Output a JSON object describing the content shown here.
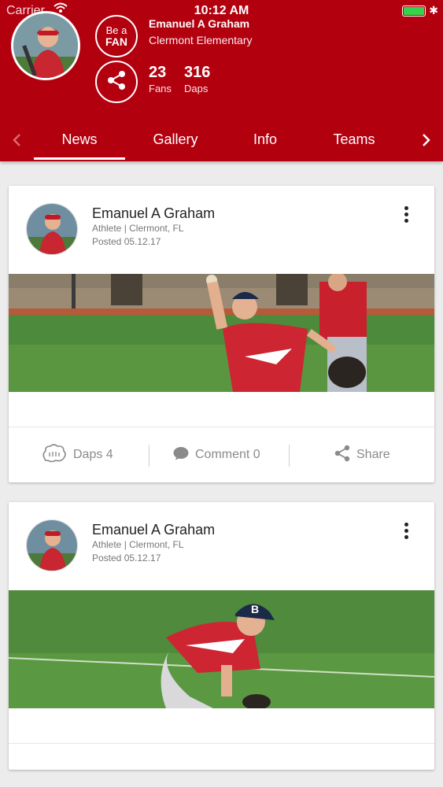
{
  "status_bar": {
    "carrier": "Carrier",
    "time": "10:12 AM"
  },
  "profile": {
    "name": "Emanuel A Graham",
    "school": "Clermont Elementary",
    "fan_button": {
      "line1": "Be a",
      "line2": "FAN"
    },
    "stats": [
      {
        "value": "23",
        "label": "Fans"
      },
      {
        "value": "316",
        "label": "Daps"
      }
    ]
  },
  "tabs": [
    {
      "label": "News",
      "active": true
    },
    {
      "label": "Gallery",
      "active": false
    },
    {
      "label": "Info",
      "active": false
    },
    {
      "label": "Teams",
      "active": false
    }
  ],
  "posts": [
    {
      "author": "Emanuel A Graham",
      "subtitle": "Athlete | Clermont, FL",
      "date": "Posted 05.12.17",
      "actions": {
        "daps": "Daps 4",
        "comment": "Comment 0",
        "share": "Share"
      }
    },
    {
      "author": "Emanuel A Graham",
      "subtitle": "Athlete | Clermont, FL",
      "date": "Posted 05.12.17"
    }
  ],
  "colors": {
    "brand_red": "#b3000f",
    "background": "#ececec",
    "battery": "#37d24b"
  },
  "icons": [
    "wifi-icon",
    "battery-icon",
    "bluetooth-icon",
    "share-icon",
    "chevron-left-icon",
    "chevron-right-icon",
    "kebab-menu-icon",
    "daps-icon",
    "comment-icon"
  ]
}
